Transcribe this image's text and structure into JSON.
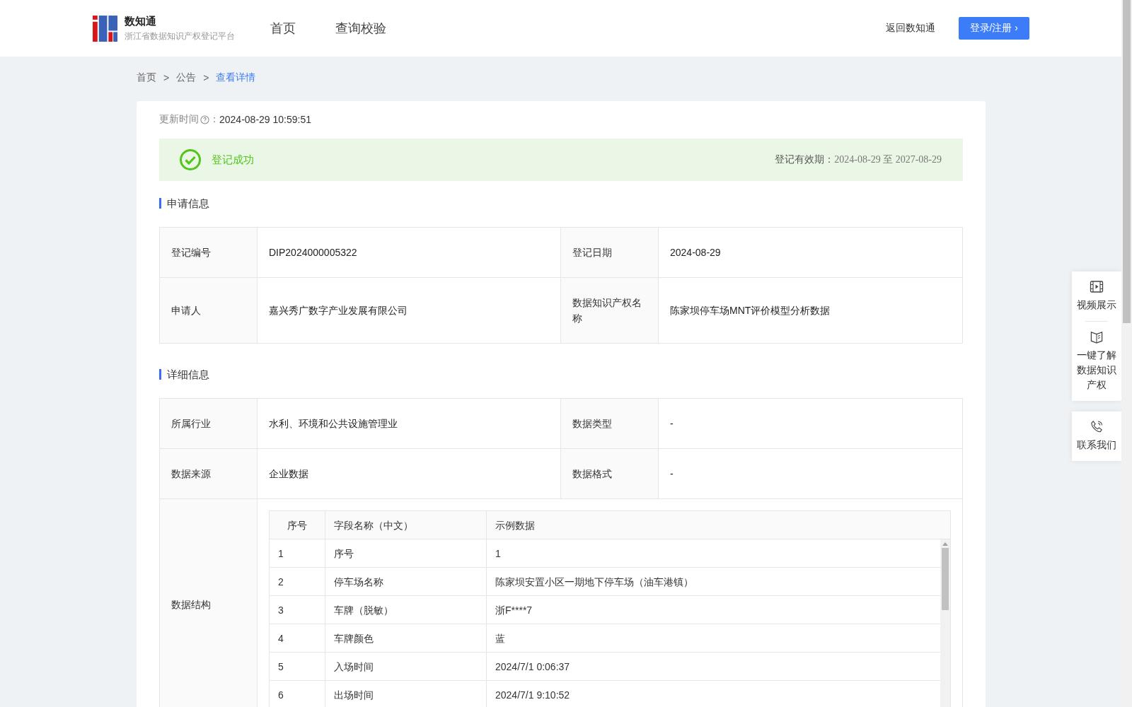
{
  "header": {
    "logo": {
      "title": "数知通",
      "subtitle": "浙江省数据知识产权登记平台"
    },
    "nav": [
      "首页",
      "查询校验"
    ],
    "back_link": "返回数知通",
    "login_button": {
      "label": "登录/注册",
      "caret": "›"
    }
  },
  "breadcrumb": {
    "separator": ">",
    "items": [
      {
        "label": "首页",
        "selected": false
      },
      {
        "label": "公告",
        "selected": false
      },
      {
        "label": "查看详情",
        "selected": true
      }
    ]
  },
  "update": {
    "label": "更新时间",
    "colon": "：",
    "time": "2024-08-29 10:59:51"
  },
  "status": {
    "text": "登记成功",
    "validity_label": "登记有效期：",
    "validity": "2024-08-29 至 2027-08-29"
  },
  "sections": [
    {
      "title": "申请信息",
      "rows": [
        [
          {
            "label": "登记编号",
            "value": "DIP2024000005322"
          },
          {
            "label": "登记日期",
            "value": "2024-08-29"
          }
        ],
        [
          {
            "label": "申请人",
            "value": "嘉兴秀广数字产业发展有限公司"
          },
          {
            "label": "数据知识产权名称",
            "value": "陈家坝停车场MNT评价模型分析数据"
          }
        ]
      ]
    },
    {
      "title": "详细信息",
      "rows": [
        [
          {
            "label": "所属行业",
            "value": "水利、环境和公共设施管理业"
          },
          {
            "label": "数据类型",
            "value": "-"
          }
        ],
        [
          {
            "label": "数据来源",
            "value": "企业数据"
          },
          {
            "label": "数据格式",
            "value": "-"
          }
        ]
      ],
      "structure": {
        "label": "数据结构",
        "columns": [
          "序号",
          "字段名称（中文）",
          "示例数据"
        ],
        "rows": [
          [
            "1",
            "序号",
            "1"
          ],
          [
            "2",
            "停车场名称",
            "陈家坝安置小区一期地下停车场（油车港镇）"
          ],
          [
            "3",
            "车牌（脱敏）",
            "浙F****7"
          ],
          [
            "4",
            "车牌颜色",
            "蓝"
          ],
          [
            "5",
            "入场时间",
            "2024/7/1 0:06:37"
          ],
          [
            "6",
            "出场时间",
            "2024/7/1 9:10:52"
          ]
        ]
      }
    }
  ],
  "side_tools": [
    {
      "kind": "video",
      "label": "视频展示"
    },
    {
      "kind": "book",
      "label": "一键了解数据知识产权"
    }
  ],
  "contact": {
    "label": "联系我们"
  }
}
